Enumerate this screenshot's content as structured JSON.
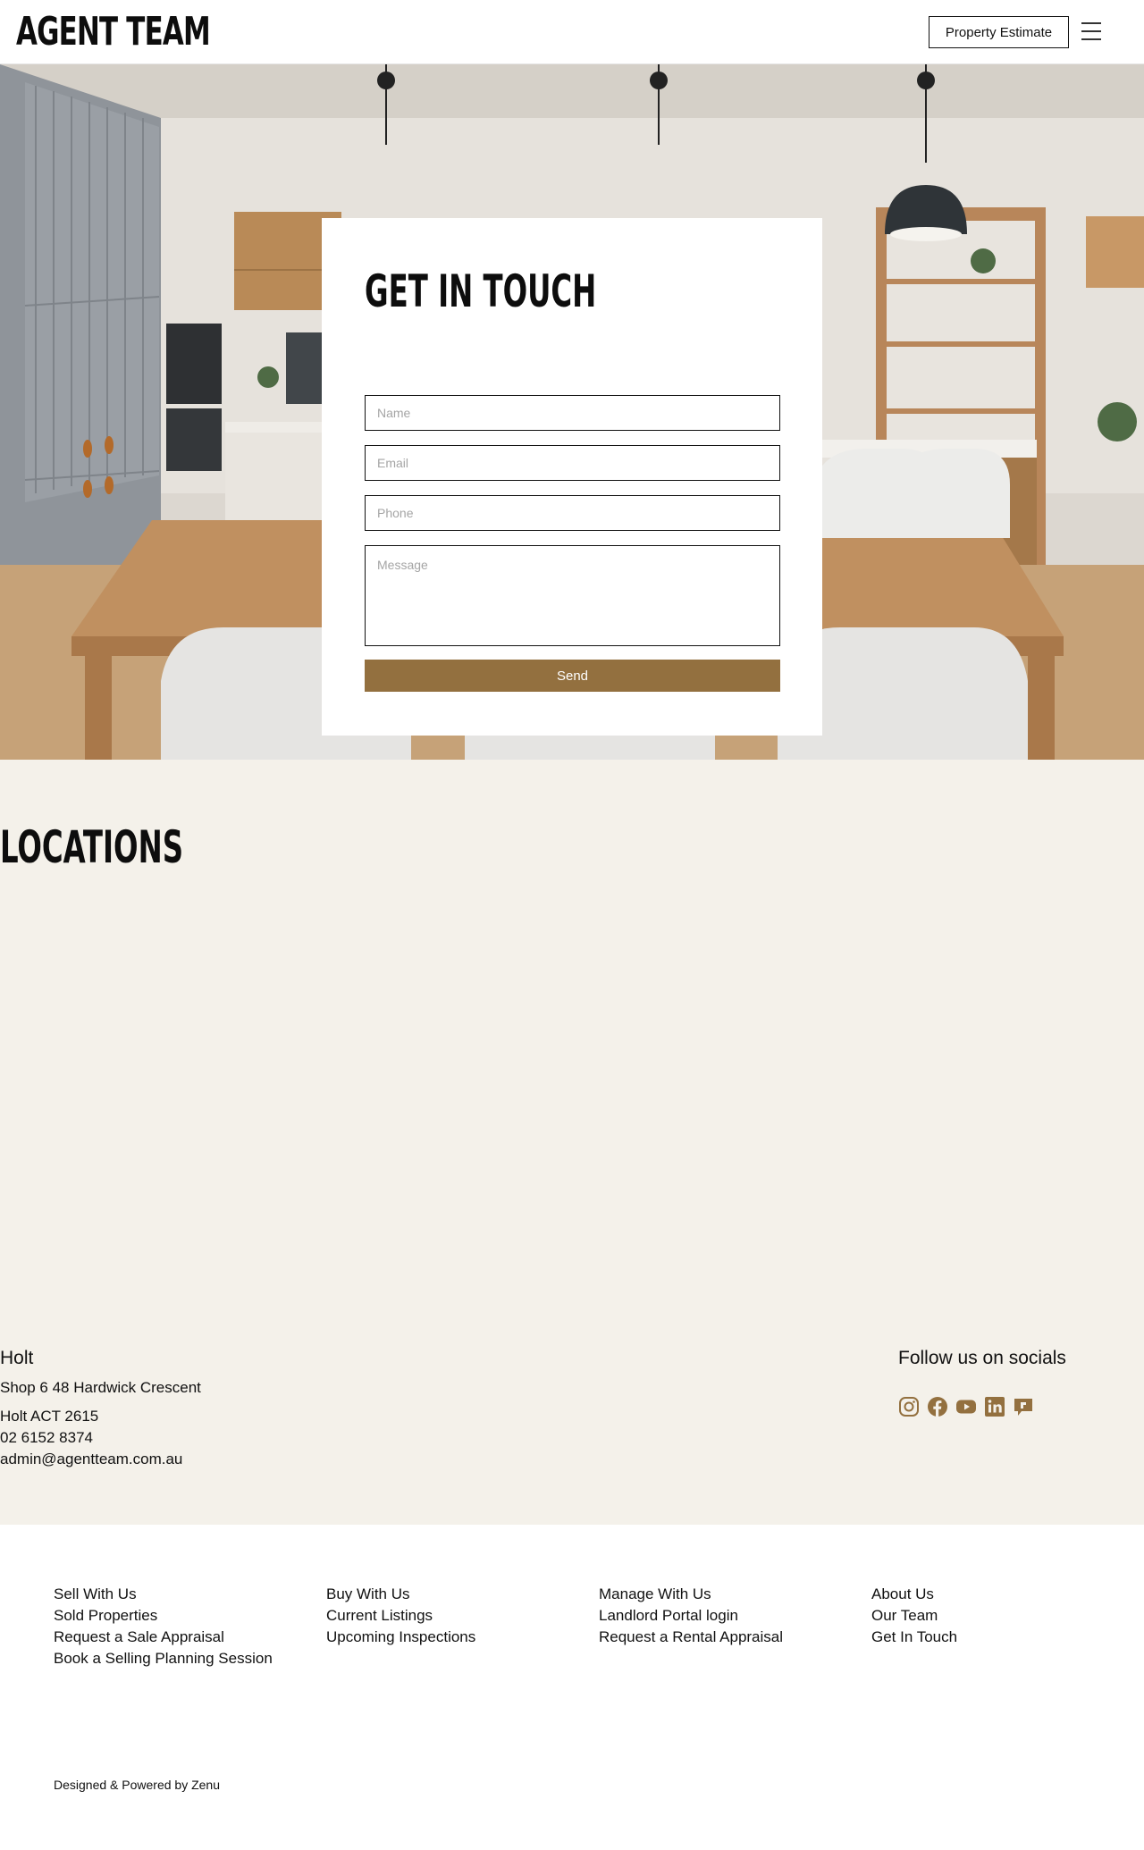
{
  "header": {
    "logo": "AGENT TEAM",
    "estimate_label": "Property Estimate"
  },
  "contact": {
    "title": "GET IN TOUCH",
    "name_placeholder": "Name",
    "email_placeholder": "Email",
    "phone_placeholder": "Phone",
    "message_placeholder": "Message",
    "send_label": "Send"
  },
  "locations": {
    "title": "LOCATIONS",
    "office": {
      "name": "Holt",
      "address_line1": "Shop 6 48 Hardwick Crescent",
      "address_line2": "Holt ACT 2615",
      "phone": "02 6152 8374",
      "email": "admin@agentteam.com.au"
    },
    "socials_title": "Follow us on socials",
    "socials": [
      "instagram-icon",
      "facebook-icon",
      "youtube-icon",
      "linkedin-icon",
      "rate-my-agent-icon"
    ],
    "accent_color": "#93703f"
  },
  "footer": {
    "columns": [
      [
        "Sell With Us",
        "Sold Properties",
        "Request a Sale Appraisal",
        "Book a Selling Planning Session"
      ],
      [
        "Buy With Us",
        "Current Listings",
        "Upcoming Inspections"
      ],
      [
        "Manage With Us",
        "Landlord Portal login",
        "Request a Rental Appraisal"
      ],
      [
        "About Us",
        "Our Team",
        "Get In Touch"
      ]
    ],
    "credit": "Designed & Powered by Zenu"
  }
}
